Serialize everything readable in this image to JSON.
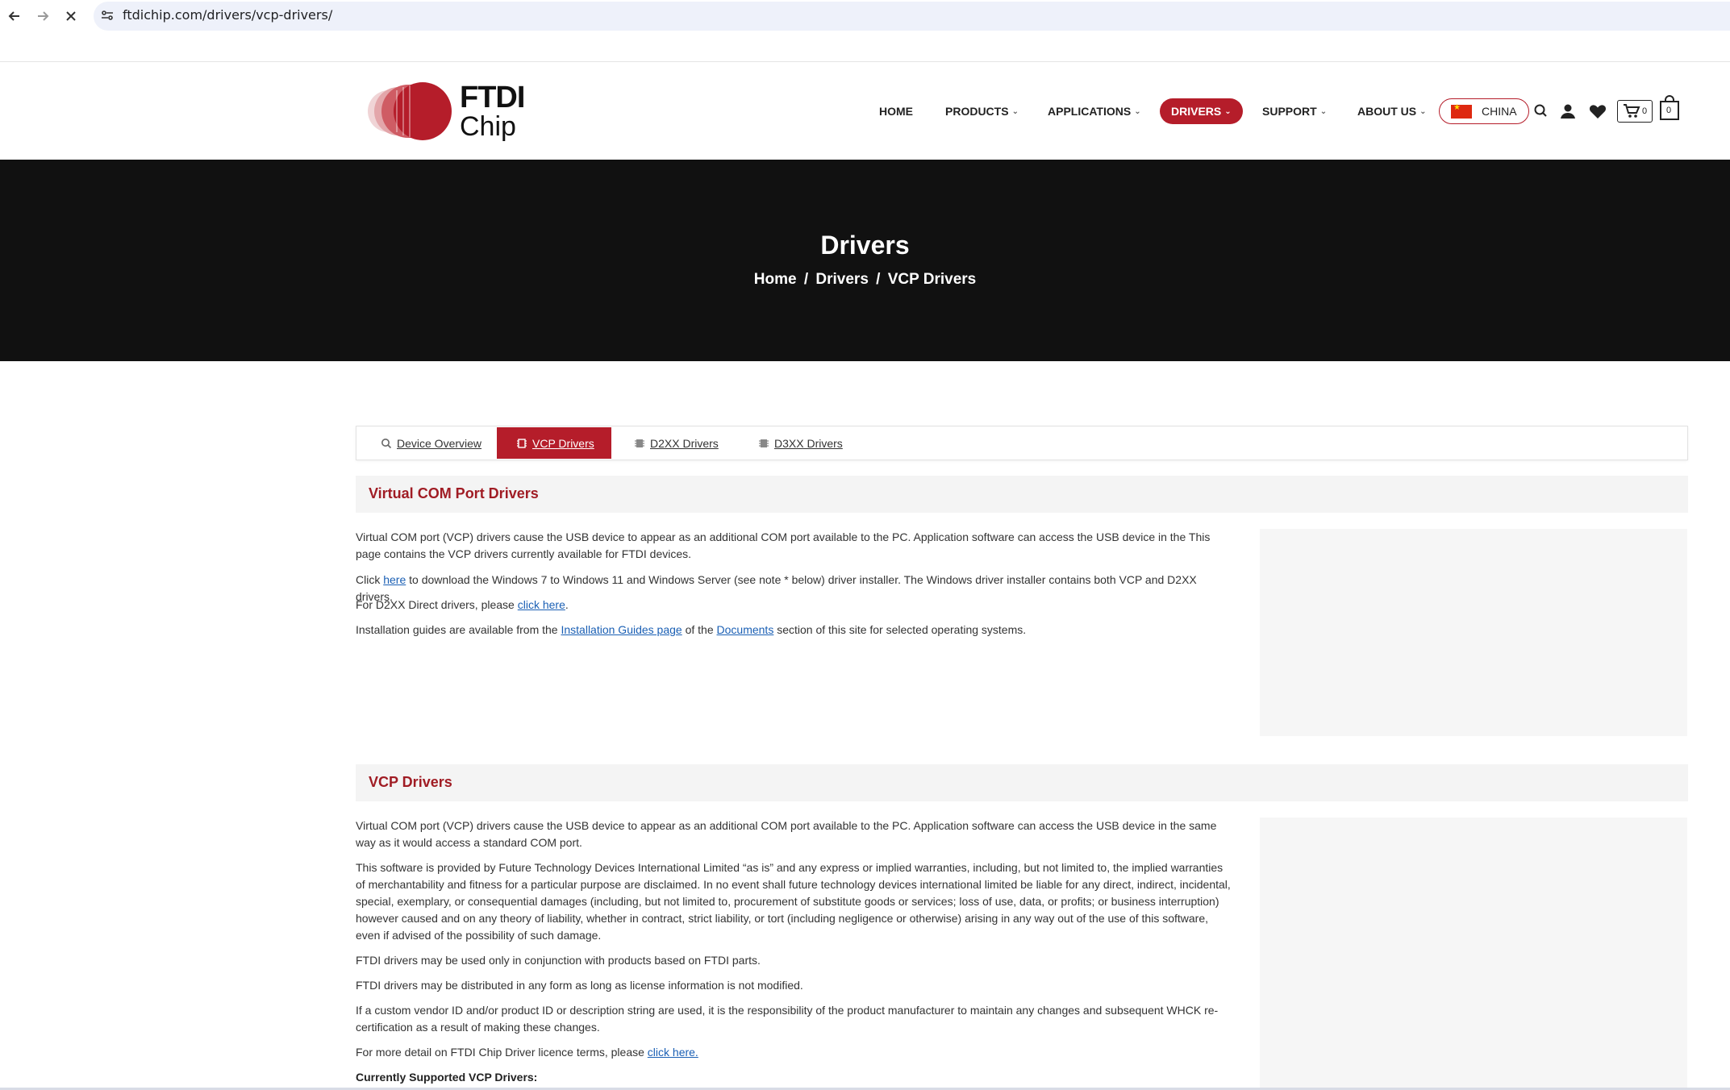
{
  "browser": {
    "url": "ftdichip.com/drivers/vcp-drivers/"
  },
  "header": {
    "logo_line1": "FTDI",
    "logo_line2": "Chip",
    "nav": [
      {
        "label": "HOME"
      },
      {
        "label": "PRODUCTS"
      },
      {
        "label": "APPLICATIONS"
      },
      {
        "label": "DRIVERS"
      },
      {
        "label": "SUPPORT"
      },
      {
        "label": "ABOUT US"
      }
    ],
    "region_label": "CHINA",
    "wishlist_count": "0",
    "cart_count": "0"
  },
  "hero": {
    "title": "Drivers",
    "breadcrumb": [
      "Home",
      "Drivers",
      "VCP Drivers"
    ],
    "separator": "/"
  },
  "tabs": [
    {
      "label": "Device Overview"
    },
    {
      "label": "VCP Drivers"
    },
    {
      "label": "D2XX Drivers"
    },
    {
      "label": "D3XX Drivers"
    }
  ],
  "section1": {
    "title": "Virtual COM Port Drivers",
    "p1": "Virtual COM port (VCP) drivers cause the USB device to appear as an additional COM port available to the PC. Application software can access the USB device in the This page contains the VCP drivers currently available for FTDI devices.",
    "p2_pre": "Click ",
    "p2_link": "here",
    "p2_post": " to download the Windows 7 to Windows 11 and Windows Server (see note * below) driver installer. The Windows driver installer contains both VCP and D2XX drivers.",
    "p3_pre": "For D2XX Direct drivers, please ",
    "p3_link": "click here",
    "p3_post": ".",
    "p4_pre": "Installation guides are available from the ",
    "p4_link1": "Installation Guides page",
    "p4_mid": " of the ",
    "p4_link2": "Documents",
    "p4_post": " section of this site for selected operating systems."
  },
  "section2": {
    "title": "VCP Drivers",
    "p1": "Virtual COM port (VCP) drivers cause the USB device to appear as an additional COM port available to the PC. Application software can access the USB device in the same way as it would access a standard COM port.",
    "p2": "This software is provided by Future Technology Devices International Limited “as is” and any express or implied warranties, including, but not limited to, the implied warranties of merchantability and fitness for a particular purpose are disclaimed. In no event shall future technology devices international limited be liable for any direct, indirect, incidental, special, exemplary, or consequential damages (including, but not limited to, procurement of substitute goods or services; loss of use, data, or profits; or business interruption) however caused and on any theory of liability, whether in contract, strict liability, or tort (including negligence or otherwise) arising in any way out of the use of this software, even if advised of the possibility of such damage.",
    "p3": "FTDI drivers may be used only in conjunction with products based on FTDI parts.",
    "p4": "FTDI drivers may be distributed in any form as long as license information is not modified.",
    "p5": "If a custom vendor ID and/or product ID or description string are used, it is the responsibility of the product manufacturer to maintain any changes and subsequent WHCK re-certification as a result of making these changes.",
    "p6_pre": "For more detail on FTDI Chip Driver licence terms, please ",
    "p6_link": "click here.",
    "p7": "Currently Supported VCP Drivers:"
  },
  "colors": {
    "brand_red": "#b51d2a",
    "heading_red": "#a01c24",
    "hero_bg": "#111111",
    "link_blue": "#1a5fb4"
  }
}
